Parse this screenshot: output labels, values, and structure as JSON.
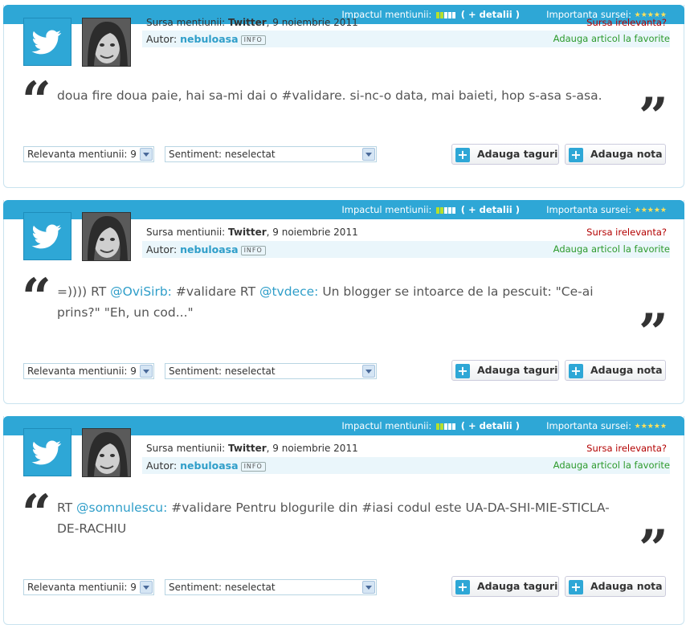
{
  "common": {
    "impact_label": "Impactul mentiunii:",
    "impact_level": 0.4,
    "detalii_label": "( + detalii )",
    "importance_label": "Importanta sursei:",
    "importance_stars": 5,
    "importance_stars_text": "★★★★★",
    "source_label": "Sursa mentiunii:",
    "irelevant_label": "Sursa irelevanta?",
    "author_label": "Autor:",
    "info_badge": "INFO",
    "favorite_label": "Adauga articol la favorite",
    "open_quote": "“",
    "close_quote": "”",
    "add_tags_label": "Adauga taguri",
    "add_note_label": "Adauga nota",
    "plus_symbol": "+",
    "colors": {
      "accent": "#2ea7d6",
      "link": "#2f9ec9",
      "irrelevant": "#b30000",
      "favorite": "#2c9a2c"
    }
  },
  "mentions": [
    {
      "source_name": "Twitter",
      "source_date": ", 9 noiembrie 2011",
      "author": "nebuloasa",
      "text_parts": [
        "doua fire doua paie, hai sa-mi dai o #validare. si-nc-o data, mai baieti, hop s-asa s-asa."
      ],
      "relevance": "Relevanta mentiunii: 9",
      "sentiment": "Sentiment:  neselectat"
    },
    {
      "source_name": "Twitter",
      "source_date": ", 9 noiembrie 2011",
      "author": "nebuloasa",
      "text_parts": [
        "=)))) RT ",
        "@OviSirb:",
        " #validare RT ",
        "@tvdece:",
        " Un blogger se intoarce de la pescuit: \"Ce-ai prins?\" \"Eh, un cod...\""
      ],
      "relevance": "Relevanta mentiunii: 9",
      "sentiment": "Sentiment:  neselectat"
    },
    {
      "source_name": "Twitter",
      "source_date": ", 9 noiembrie 2011",
      "author": "nebuloasa",
      "text_parts": [
        "RT ",
        "@somnulescu:",
        " #validare Pentru blogurile din #iasi codul este UA-DA-SHI-MIE-STICLA-DE-RACHIU"
      ],
      "relevance": "Relevanta mentiunii: 9",
      "sentiment": "Sentiment:  neselectat"
    }
  ]
}
